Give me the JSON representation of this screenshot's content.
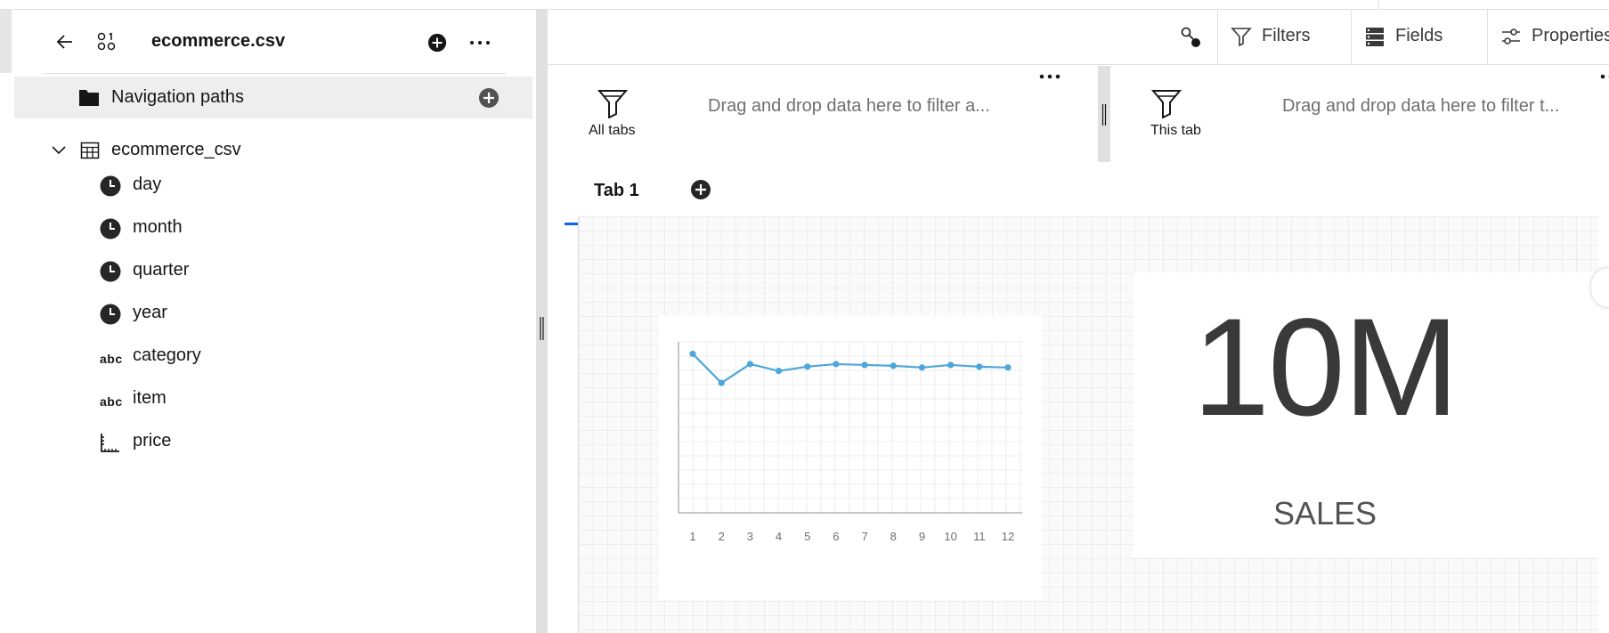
{
  "left_panel": {
    "title": "ecommerce.csv",
    "nav_paths_label": "Navigation paths",
    "table": {
      "label": "ecommerce_csv",
      "fields": [
        {
          "name": "day",
          "icon": "clock-icon"
        },
        {
          "name": "month",
          "icon": "clock-icon"
        },
        {
          "name": "quarter",
          "icon": "clock-icon"
        },
        {
          "name": "year",
          "icon": "clock-icon"
        },
        {
          "name": "category",
          "icon": "text-abc-icon",
          "glyph": "abc"
        },
        {
          "name": "item",
          "icon": "text-abc-icon",
          "glyph": "abc"
        },
        {
          "name": "price",
          "icon": "measure-ruler-icon"
        }
      ]
    }
  },
  "toolbar": {
    "filters_label": "Filters",
    "fields_label": "Fields",
    "properties_label": "Properties"
  },
  "filter_bar": {
    "all_tabs_label": "All tabs",
    "all_tabs_drop": "Drag and drop data here to filter a...",
    "this_tab_label": "This tab",
    "this_tab_drop": "Drag and drop data here to filter t..."
  },
  "tabs": [
    {
      "label": "Tab 1",
      "active": true
    }
  ],
  "kpi": {
    "value": "10M",
    "label": "SALES"
  },
  "chart_data": {
    "type": "line",
    "title": "",
    "xlabel": "",
    "ylabel": "",
    "x": [
      "1",
      "2",
      "3",
      "4",
      "5",
      "6",
      "7",
      "8",
      "9",
      "10",
      "11",
      "12"
    ],
    "series": [
      {
        "values": [
          0.93,
          0.76,
          0.87,
          0.83,
          0.855,
          0.87,
          0.865,
          0.86,
          0.85,
          0.865,
          0.855,
          0.85
        ]
      }
    ],
    "ylim": [
      0,
      1
    ],
    "grid": true,
    "color": "#4da6d9"
  }
}
